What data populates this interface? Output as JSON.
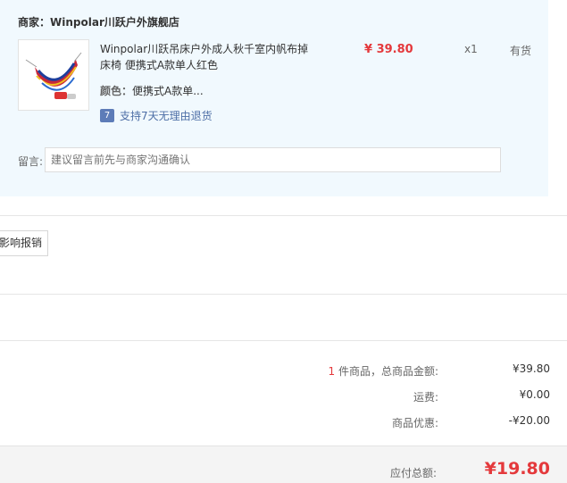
{
  "shop": {
    "label": "商家：Winpolar川跃户外旗舰店"
  },
  "item": {
    "title": "Winpolar川跃吊床户外成人秋千室内帆布掉床椅 便携式A款单人红色",
    "price": "¥ 39.80",
    "quantity": "x1",
    "stock_status": "有货",
    "spec_label": "颜色：",
    "spec_value": "便携式A款单...",
    "return_icon_text": "7",
    "return_policy": "支持7天无理由退货"
  },
  "note": {
    "label": "留言:",
    "placeholder": "建议留言前先与商家沟通确认"
  },
  "invoice": {
    "button_label": "影响报销"
  },
  "summary": {
    "count": "1",
    "goods_label": " 件商品，总商品金额:",
    "goods_amount": "¥39.80",
    "shipping_label": "运费:",
    "shipping_amount": "¥0.00",
    "discount_label": "商品优惠:",
    "discount_amount": "-¥20.00",
    "total_label": "应付总额:",
    "total_amount": "¥19.80"
  },
  "colors": {
    "accent_red": "#e4393c",
    "panel_bg": "#f1f9fe",
    "link_blue": "#4d6ea6"
  }
}
